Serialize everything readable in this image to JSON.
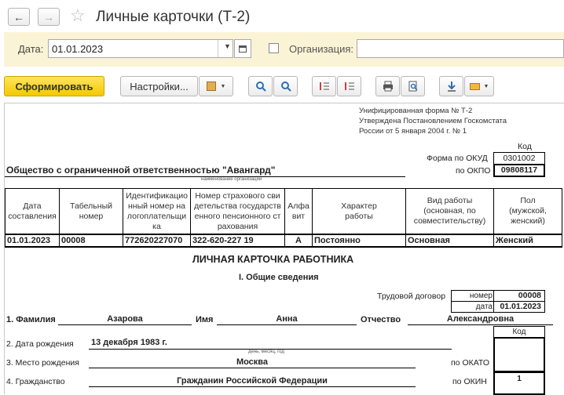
{
  "window": {
    "title": "Личные карточки (Т-2)"
  },
  "params": {
    "date_label": "Дата:",
    "date_value": "01.01.2023",
    "org_label": "Организация:",
    "org_value": ""
  },
  "toolbar": {
    "generate_label": "Сформировать",
    "settings_label": "Настройки..."
  },
  "form": {
    "header_line1": "Унифицированная форма № Т-2",
    "header_line2": "Утверждена Постановлением Госкомстата",
    "header_line3": "России от 5 января 2004 г. № 1",
    "code_header": "Код",
    "okud_label": "Форма по ОКУД",
    "okud_value": "0301002",
    "okpo_label": "по ОКПО",
    "okpo_value": "09808117",
    "org_name": "Общество с ограниченной ответственностью \"Авангард\"",
    "org_caption": "наименование организации",
    "table_headers": [
      "Дата составления",
      "Табельный номер",
      "Идентификационный номер налогоплательщика",
      "Номер страхового свидетельства государственного пенсионного страхования",
      "Алфавит",
      "Характер работы",
      "Вид работы (основная, по совместительству)",
      "Пол (мужской, женский)"
    ],
    "table_row": [
      "01.01.2023",
      "00008",
      "772620227070",
      "322-620-227 19",
      "А",
      "Постоянно",
      "Основная",
      "Женский"
    ],
    "card_title": "ЛИЧНАЯ КАРТОЧКА РАБОТНИКА",
    "section_title": "I. Общие сведения",
    "contract_label": "Трудовой договор",
    "contract_number_label": "номер",
    "contract_number": "00008",
    "contract_date_label": "дата",
    "contract_date": "01.01.2023",
    "lastname_label": "1. Фамилия",
    "lastname": "Азарова",
    "firstname_label": "Имя",
    "firstname": "Анна",
    "patronymic_label": "Отчество",
    "patronymic": "Александровна",
    "code_header2": "Код",
    "birthdate_label": "2. Дата рождения",
    "birthdate": "13 декабря 1983 г.",
    "birthdate_caption": "день, месяц, год",
    "birthplace_label": "3. Место рождения",
    "birthplace": "Москва",
    "okato_label": "по ОКАТО",
    "citizenship_label": "4. Гражданство",
    "citizenship": "Гражданин Российской Федерации",
    "okin_label": "по ОКИН",
    "okin_value": "1"
  }
}
